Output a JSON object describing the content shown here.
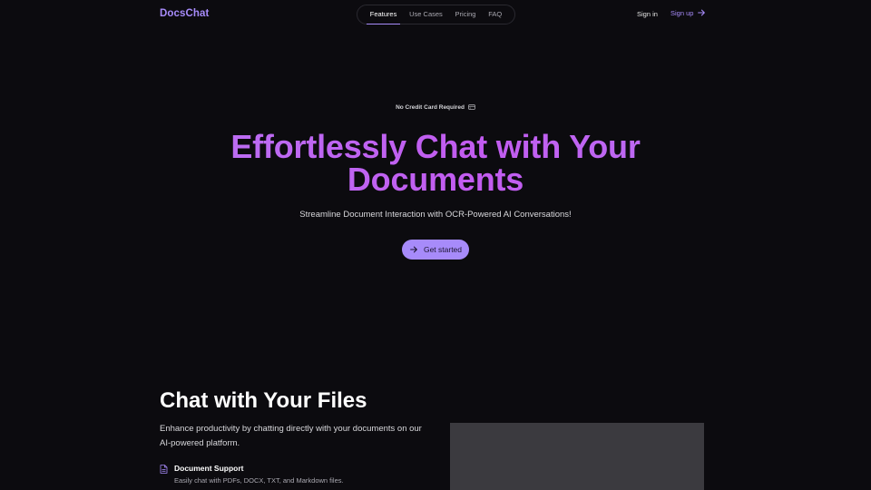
{
  "header": {
    "logo": "DocsChat",
    "nav": [
      {
        "label": "Features",
        "active": true
      },
      {
        "label": "Use Cases",
        "active": false
      },
      {
        "label": "Pricing",
        "active": false
      },
      {
        "label": "FAQ",
        "active": false
      }
    ],
    "signin_label": "Sign in",
    "signup_label": "Sign up"
  },
  "hero": {
    "badge": "No Credit Card Required",
    "badge_icon": "credit-card-icon",
    "title_line1": "Effortlessly Chat with Your",
    "title_line2": "Documents",
    "subtitle": "Streamline Document Interaction with OCR-Powered AI Conversations!",
    "cta_label": "Get started",
    "cta_icon": "arrow-right-icon"
  },
  "features": {
    "title": "Chat with Your Files",
    "description": "Enhance productivity by chatting directly with your documents on our AI-powered platform.",
    "items": [
      {
        "icon": "document-icon",
        "title": "Document Support",
        "description": "Easily chat with PDFs, DOCX, TXT, and Markdown files."
      }
    ]
  },
  "colors": {
    "background": "#0c0b0f",
    "accent": "#a78bfa",
    "title_gradient_start": "#b67cf5",
    "title_gradient_mid": "#c25bf0",
    "preview_panel": "#3b3a3f"
  }
}
